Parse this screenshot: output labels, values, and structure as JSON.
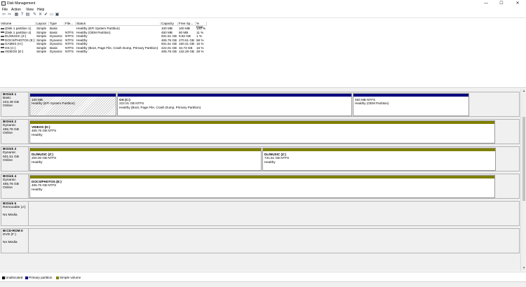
{
  "window": {
    "title": "Disk Management",
    "minimize_glyph": "—",
    "maximize_glyph": "☐",
    "close_glyph": "✕"
  },
  "menu": [
    "File",
    "Action",
    "View",
    "Help"
  ],
  "toolbar": [
    {
      "name": "back-icon",
      "glyph": "⇦"
    },
    {
      "name": "forward-icon",
      "glyph": "⇨"
    },
    {
      "name": "console-tree-icon",
      "glyph": "▦"
    },
    {
      "name": "help-icon",
      "glyph": "?"
    },
    {
      "name": "properties-icon",
      "glyph": "▤"
    },
    {
      "name": "refresh-icon",
      "glyph": "✎"
    },
    {
      "name": "delete-icon",
      "glyph": "✕"
    },
    {
      "name": "check-icon",
      "glyph": "✔"
    },
    {
      "name": "open-icon",
      "glyph": "▭"
    },
    {
      "name": "view-icon",
      "glyph": "▣"
    }
  ],
  "volumes": {
    "columns": [
      "Volume",
      "Layout",
      "Type",
      "File...",
      "Status",
      "Capacity",
      "Free Sp...",
      "% Free"
    ],
    "rows": [
      [
        "(Disk 1 partition 1)",
        "Simple",
        "Basic",
        "",
        "Healthy (EFI System Partition)",
        "100 MB",
        "100 MB",
        "100 %"
      ],
      [
        "(Disk 1 partition 4)",
        "Simple",
        "Basic",
        "NTFS",
        "Healthy (OEM Partition)",
        "450 MB",
        "50 MB",
        "11 %"
      ],
      [
        "DL/MUSIC (Z:)",
        "Simple",
        "Dynamic",
        "NTFS",
        "Healthy",
        "931.51 GB",
        "9.82 GB",
        "1 %"
      ],
      [
        "DOCS/PHOTOS (E:)",
        "Simple",
        "Dynamic",
        "NTFS",
        "Healthy",
        "465.76 GB",
        "270.51 GB",
        "58 %"
      ],
      [
        "GAMES (H:)",
        "Simple",
        "Dynamic",
        "NTFS",
        "Healthy",
        "931.51 GB",
        "150.41 GB",
        "16 %"
      ],
      [
        "OS (C:)",
        "Simple",
        "Basic",
        "NTFS",
        "Healthy (Boot, Page File, Crash Dump, Primary Partition)",
        "222.01 GB",
        "34.73 GB",
        "16 %"
      ],
      [
        "VIDEOS (D:)",
        "Simple",
        "Dynamic",
        "NTFS",
        "Healthy",
        "465.76 GB",
        "132.29 GB",
        "28 %"
      ]
    ]
  },
  "disks": [
    {
      "name": "Disk 1",
      "kind": "Basic",
      "size": "223.49 GB",
      "state": "Online",
      "partitions": [
        {
          "name": "",
          "size": "100 MB",
          "status": "Healthy (EFI System Partition)",
          "bar": "#00007f",
          "hatched": true
        },
        {
          "name": "OS (C:)",
          "size": "222.01 GB NTFS",
          "status": "Healthy (Boot, Page File, Crash Dump, Primary Partition)",
          "bar": "#00007f",
          "hatched": false
        },
        {
          "name": "",
          "size": "450 MB NTFS",
          "status": "Healthy (OEM Partition)",
          "bar": "#00007f",
          "hatched": false
        }
      ]
    },
    {
      "name": "Disk 2",
      "kind": "Dynamic",
      "size": "465.76 GB",
      "state": "Online",
      "partitions": [
        {
          "name": "VIDEOS (D:)",
          "size": "465.76 GB NTFS",
          "status": "Healthy",
          "bar": "#808000",
          "hatched": false
        }
      ]
    },
    {
      "name": "Disk 3",
      "kind": "Dynamic",
      "size": "931.51 GB",
      "state": "Online",
      "partitions": [
        {
          "name": "DL/MUSIC (Z:)",
          "size": "200.00 GB NTFS",
          "status": "Healthy",
          "bar": "#808000",
          "hatched": false
        },
        {
          "name": "DL/MUSIC (Z:)",
          "size": "731.51 GB NTFS",
          "status": "Healthy",
          "bar": "#808000",
          "hatched": false
        }
      ]
    },
    {
      "name": "Disk 4",
      "kind": "Dynamic",
      "size": "465.76 GB",
      "state": "Online",
      "partitions": [
        {
          "name": "DOCS/PHOTOS (E:)",
          "size": "465.76 GB NTFS",
          "status": "Healthy",
          "bar": "#808000",
          "hatched": false
        }
      ]
    },
    {
      "name": "Disk 5",
      "kind": "Removable (J:)",
      "size": "",
      "state": "No Media",
      "partitions": []
    },
    {
      "name": "CD-ROM 0",
      "kind": "DVD (F:)",
      "size": "",
      "state": "No Media",
      "partitions": []
    }
  ],
  "legend": [
    {
      "label": "Unallocated",
      "color": "#000000"
    },
    {
      "label": "Primary partition",
      "color": "#00007f"
    },
    {
      "label": "Simple volume",
      "color": "#808000"
    }
  ]
}
